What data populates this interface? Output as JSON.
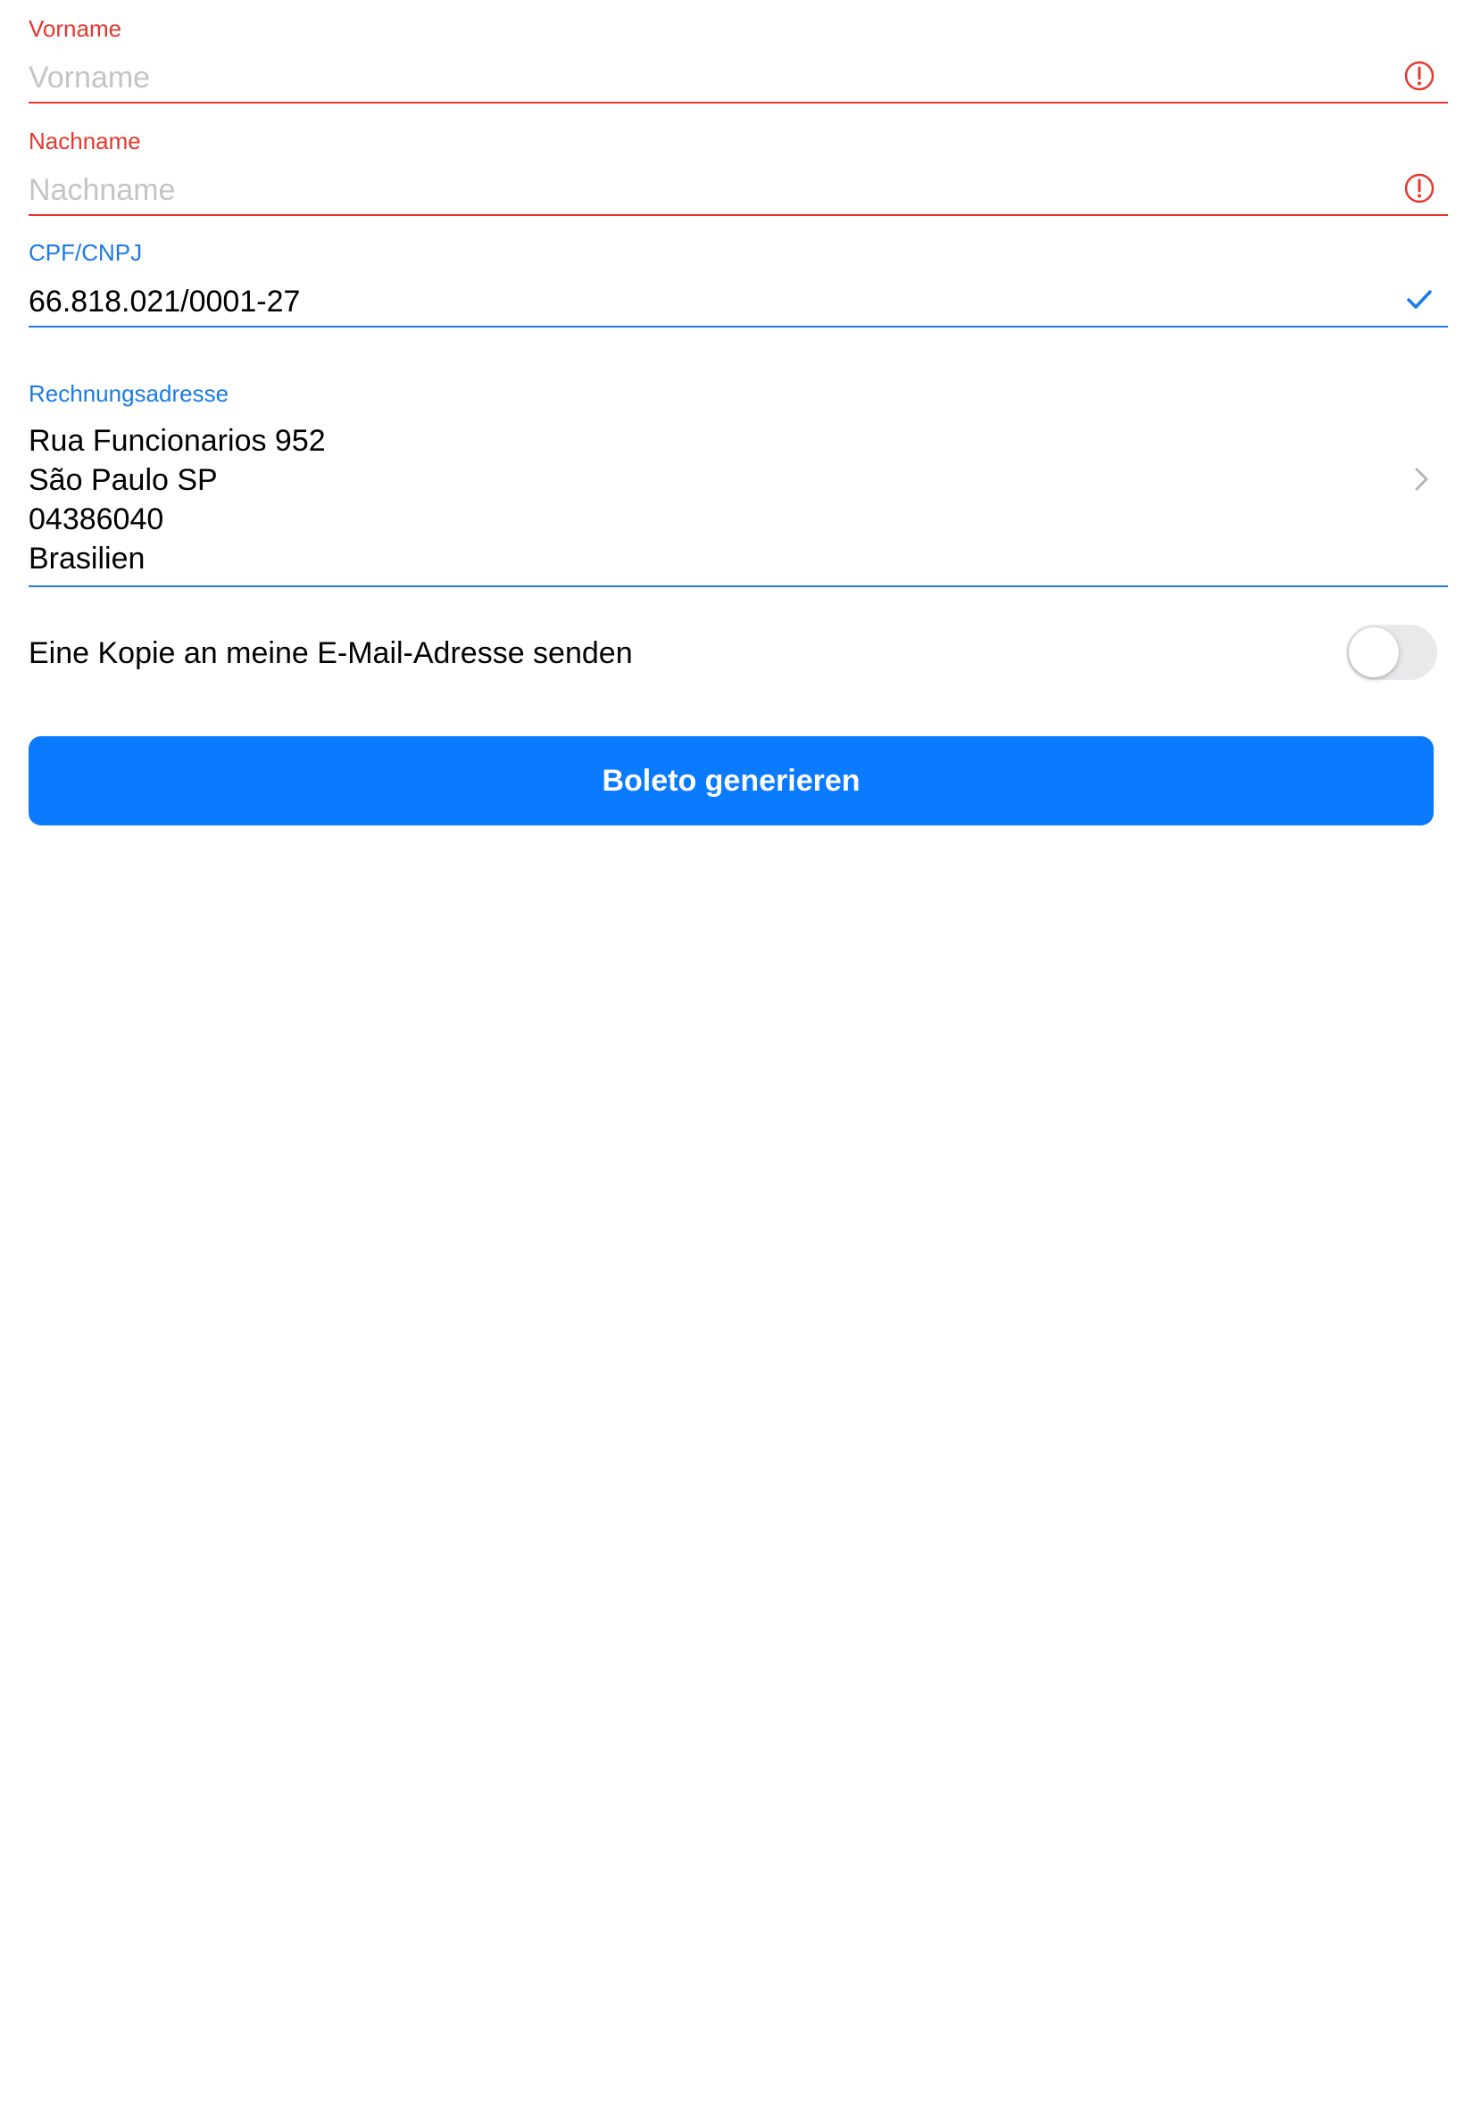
{
  "form": {
    "first_name": {
      "label": "Vorname",
      "placeholder": "Vorname",
      "value": "",
      "status": "error"
    },
    "last_name": {
      "label": "Nachname",
      "placeholder": "Nachname",
      "value": "",
      "status": "error"
    },
    "tax_id": {
      "label": "CPF/CNPJ",
      "value": "66.818.021/0001-27",
      "status": "valid"
    },
    "billing_address": {
      "label": "Rechnungsadresse",
      "lines": [
        "Rua Funcionarios 952",
        "São Paulo SP",
        "04386040",
        "Brasilien"
      ]
    },
    "email_copy": {
      "label": "Eine Kopie an meine E-Mail-Adresse senden",
      "enabled": false
    },
    "submit_label": "Boleto generieren"
  },
  "colors": {
    "error": "#e8362d",
    "accent": "#1a7ae8",
    "button": "#0a7aff",
    "placeholder": "#c4c4c6",
    "toggle_off": "#e9e9eb"
  },
  "icons": {
    "error": "exclamation-circle-icon",
    "valid": "checkmark-icon",
    "disclosure": "chevron-right-icon"
  }
}
